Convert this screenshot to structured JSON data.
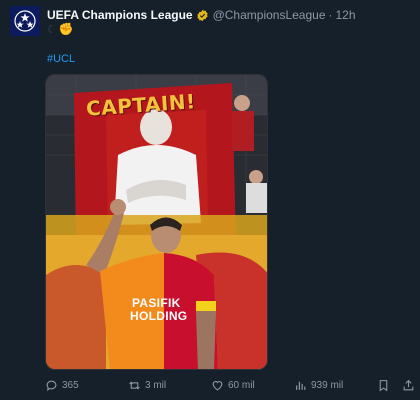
{
  "tweet": {
    "display_name": "UEFA Champions League",
    "handle": "@ChampionsLeague",
    "separator": "·",
    "time": "12h",
    "text_emoji_moon": "☾",
    "text_emoji_fist": "✊",
    "hashtag": "#UCL"
  },
  "media": {
    "banner_text": "CAPTAIN!",
    "jersey_line1": "PASIFIK",
    "jersey_line2": "HOLDING"
  },
  "actions": {
    "replies": "365",
    "retweets": "3 mil",
    "likes": "60 mil",
    "views": "939 mil"
  },
  "colors": {
    "background": "#15202b",
    "link": "#1d9bf0",
    "secondary_text": "#8b98a5",
    "verified": "#e2b719"
  },
  "icons": {
    "verified": "verified-badge-icon",
    "reply": "reply-icon",
    "retweet": "retweet-icon",
    "like": "heart-icon",
    "views": "views-icon",
    "bookmark": "bookmark-icon",
    "share": "share-icon"
  }
}
